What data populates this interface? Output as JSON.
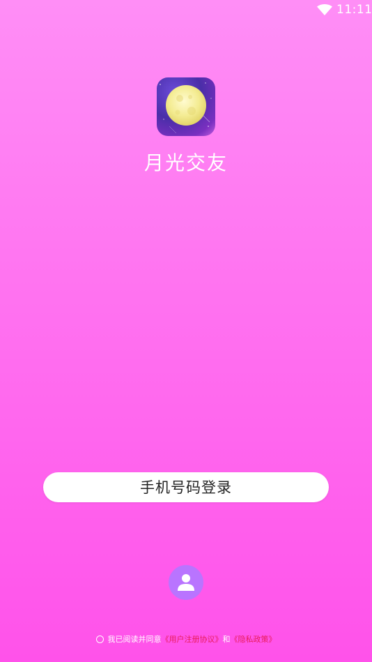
{
  "status_bar": {
    "time": "11:11",
    "wifi_icon": "wifi-icon"
  },
  "app": {
    "name": "月光交友",
    "logo_icon": "moon-logo-icon"
  },
  "login": {
    "phone_login_label": "手机号码登录"
  },
  "profile_icon": "person-icon",
  "agreement": {
    "prefix": "我已阅读并同意",
    "user_agreement_link": "《用户注册协议》",
    "conjunction": "和",
    "privacy_link": "《隐私政策》"
  },
  "colors": {
    "background_top": "#ff8ef6",
    "background_bottom": "#ff52ea",
    "link": "#e81c5a",
    "profile_button": "#b974ff"
  }
}
